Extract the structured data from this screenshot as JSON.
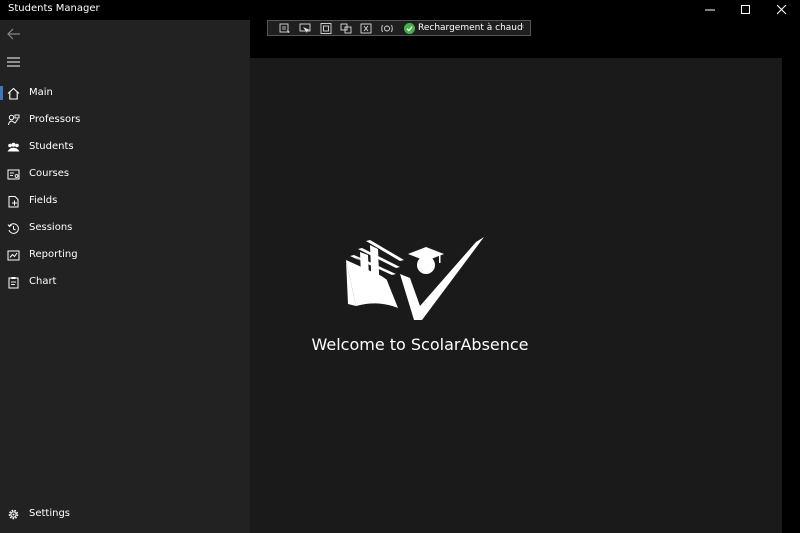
{
  "window": {
    "title": "Students Manager",
    "controls": [
      "minimize",
      "maximize",
      "close"
    ]
  },
  "debug_toolbar": {
    "tools": [
      "live-visual-tree-icon",
      "select-element-icon",
      "display-layout-adorners-icon",
      "track-focus-icon",
      "binding-failures-icon",
      "accessibility-icon"
    ],
    "hot_reload_label": "Rechargement à chaud",
    "hot_reload_status_color": "#46b04a"
  },
  "sidebar": {
    "items": [
      {
        "label": "Main",
        "icon": "home-icon",
        "active": true
      },
      {
        "label": "Professors",
        "icon": "professor-icon",
        "active": false
      },
      {
        "label": "Students",
        "icon": "people-icon",
        "active": false
      },
      {
        "label": "Courses",
        "icon": "courses-icon",
        "active": false
      },
      {
        "label": "Fields",
        "icon": "fields-icon",
        "active": false
      },
      {
        "label": "Sessions",
        "icon": "history-icon",
        "active": false
      },
      {
        "label": "Reporting",
        "icon": "report-icon",
        "active": false
      },
      {
        "label": "Chart",
        "icon": "clipboard-icon",
        "active": false
      }
    ],
    "settings_label": "Settings",
    "accent_color": "#3b78c4"
  },
  "main": {
    "welcome_text": "Welcome to ScolarAbsence",
    "logo": "scolarabsence-book-check-logo"
  }
}
